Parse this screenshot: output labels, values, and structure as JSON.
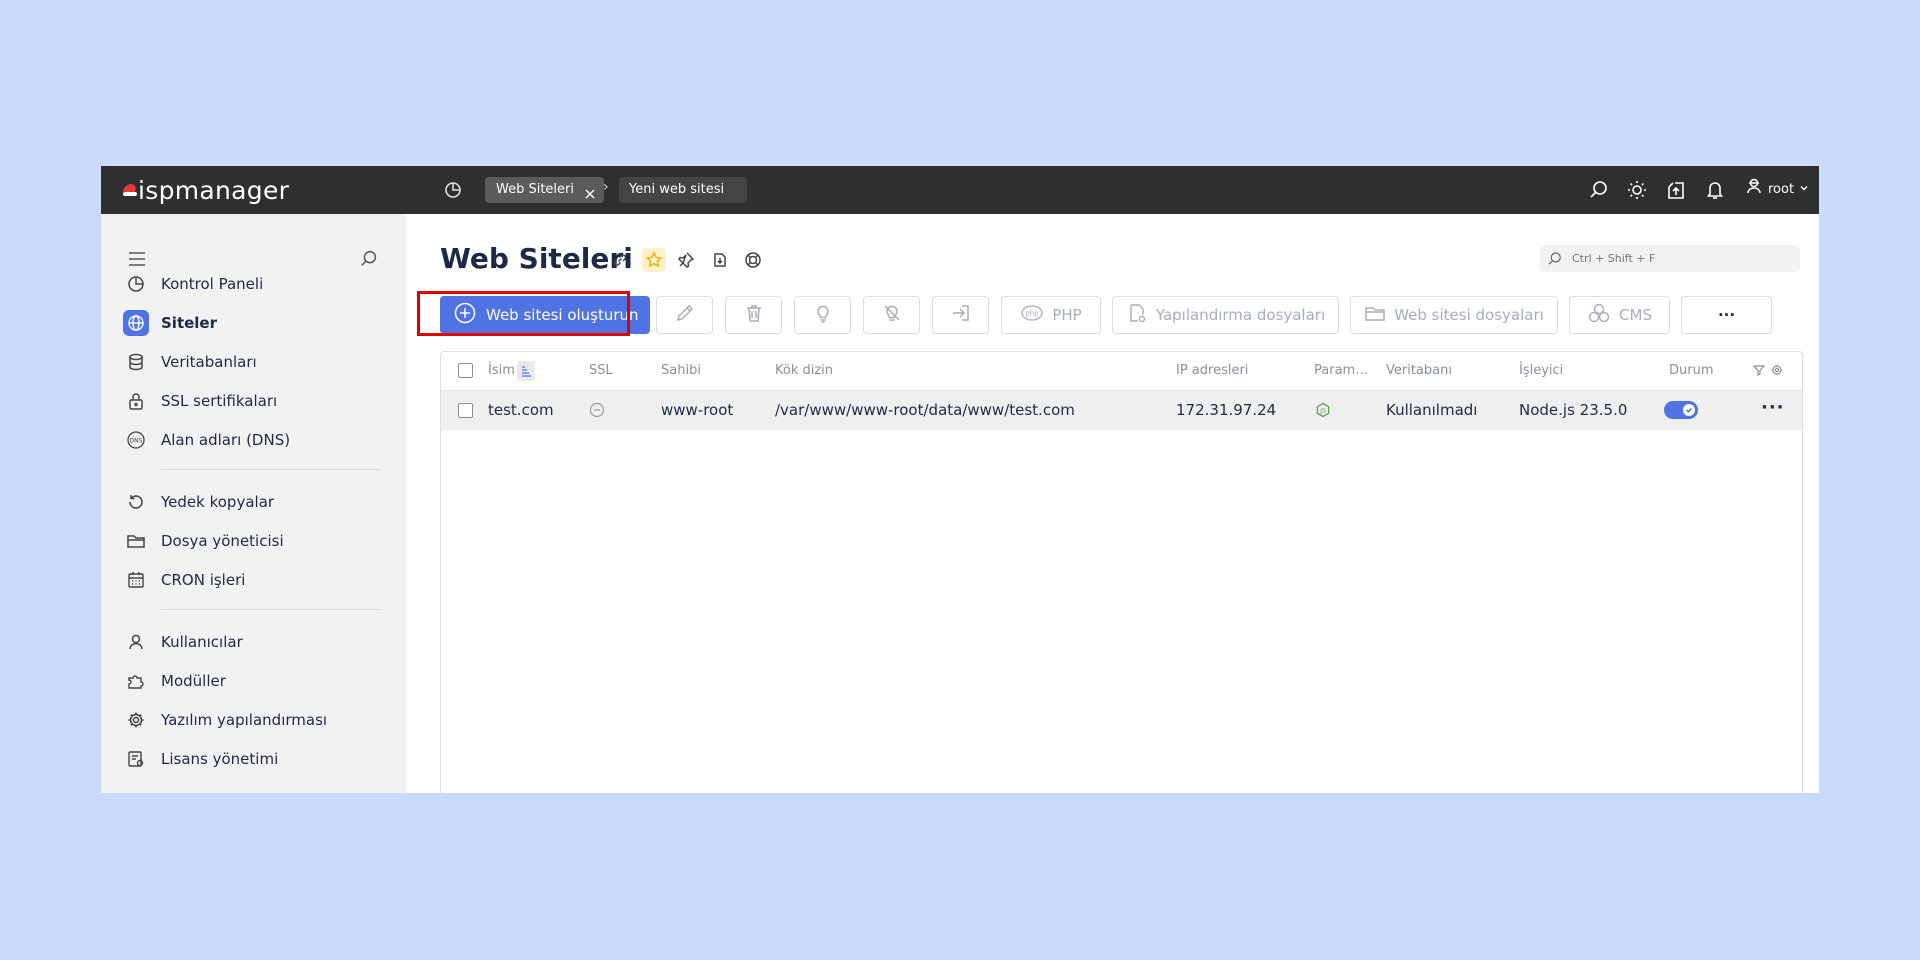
{
  "topbar": {
    "logo": "ispmanager",
    "breadcrumbs": [
      {
        "label": "Web Siteleri"
      },
      {
        "label": "Yeni web sitesi"
      }
    ],
    "breadcrumb_sep": "›",
    "user": "root"
  },
  "sidebar": {
    "groups": [
      [
        {
          "label": "Kontrol Paneli",
          "icon": "dashboard-icon"
        },
        {
          "label": "Siteler",
          "icon": "globe-icon",
          "active": true
        },
        {
          "label": "Veritabanları",
          "icon": "database-icon"
        },
        {
          "label": "SSL sertifikaları",
          "icon": "lock-icon"
        },
        {
          "label": "Alan adları (DNS)",
          "icon": "dns-icon"
        }
      ],
      [
        {
          "label": "Yedek kopyalar",
          "icon": "backup-icon"
        },
        {
          "label": "Dosya yöneticisi",
          "icon": "folder-icon"
        },
        {
          "label": "CRON işleri",
          "icon": "calendar-icon"
        }
      ],
      [
        {
          "label": "Kullanıcılar",
          "icon": "user-icon"
        },
        {
          "label": "Modüller",
          "icon": "puzzle-icon"
        },
        {
          "label": "Yazılım yapılandırması",
          "icon": "gear-icon"
        },
        {
          "label": "Lisans yönetimi",
          "icon": "license-icon"
        }
      ]
    ]
  },
  "main": {
    "title": "Web Siteleri",
    "search_placeholder": "Ctrl + Shift + F",
    "toolbar": {
      "create": "Web sitesi oluşturun",
      "php": "PHP",
      "config_files": "Yapılandırma dosyaları",
      "site_files": "Web sitesi dosyaları",
      "cms": "CMS",
      "more": "···"
    },
    "table": {
      "columns": {
        "name": "İsim",
        "ssl": "SSL",
        "owner": "Sahibi",
        "root_dir": "Kök dizin",
        "ip": "IP adresleri",
        "params": "Param…",
        "db": "Veritabanı",
        "handler": "İşleyici",
        "status": "Durum"
      },
      "rows": [
        {
          "name": "test.com",
          "owner": "www-root",
          "root_dir": "/var/www/www-root/data/www/test.com",
          "ip": "172.31.97.24",
          "db": "Kullanılmadı",
          "handler": "Node.js 23.5.0",
          "status_enabled": true
        }
      ]
    }
  },
  "colors": {
    "accent": "#4f73e3",
    "topbar": "#2f2f2f",
    "background": "#cbdafa",
    "highlight": "#e00000"
  }
}
